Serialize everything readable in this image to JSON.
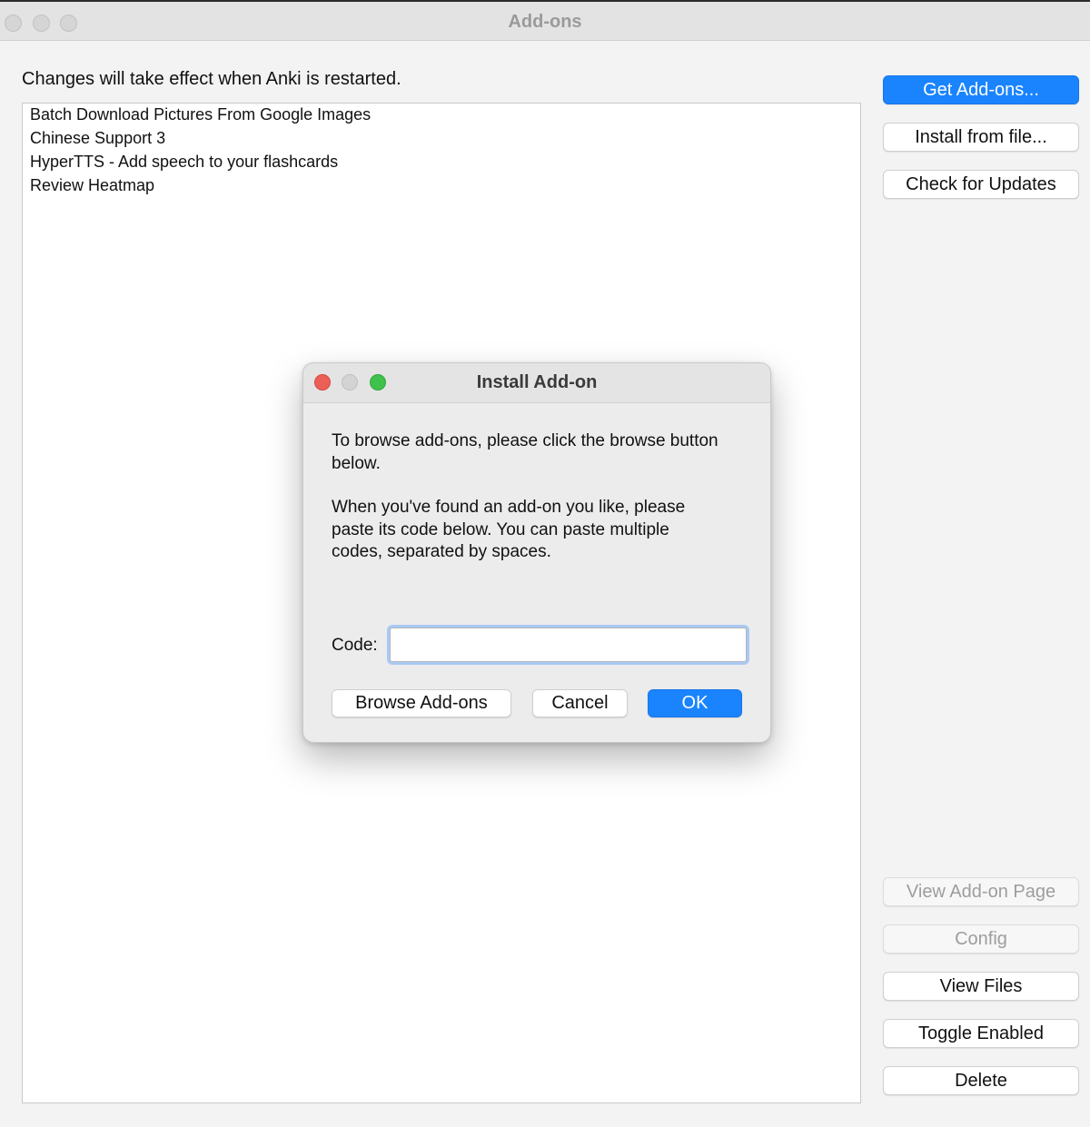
{
  "window": {
    "title": "Add-ons"
  },
  "notice": "Changes will take effect when Anki is restarted.",
  "addons": [
    "Batch Download Pictures From Google Images",
    "Chinese Support 3",
    "HyperTTS - Add speech to your flashcards",
    "Review Heatmap"
  ],
  "sidebar": {
    "get_addons": "Get Add-ons...",
    "install_from_file": "Install from file...",
    "check_updates": "Check for Updates",
    "view_addon_page": "View Add-on Page",
    "config": "Config",
    "view_files": "View Files",
    "toggle_enabled": "Toggle Enabled",
    "delete": "Delete"
  },
  "dialog": {
    "title": "Install Add-on",
    "paragraph1": "To browse add-ons, please click the browse button below.",
    "paragraph2": "When you've found an add-on you like, please paste its code below. You can paste multiple codes, separated by spaces.",
    "code_label": "Code:",
    "code_value": "",
    "browse_button": "Browse Add-ons",
    "cancel_button": "Cancel",
    "ok_button": "OK"
  },
  "colors": {
    "accent": "#1a84ff",
    "close": "#ec5f57",
    "maximize": "#3fc14b"
  }
}
